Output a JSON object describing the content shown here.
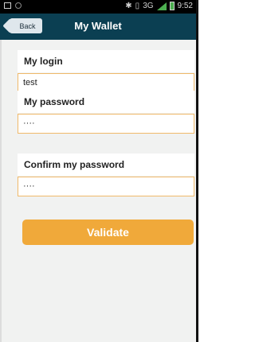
{
  "status_bar": {
    "time": "9:52"
  },
  "header": {
    "back_label": "Back",
    "title": "My Wallet"
  },
  "form": {
    "login_label": "My login",
    "login_value": "test",
    "password_label": "My password",
    "password_value": "····",
    "confirm_label": "Confirm my password",
    "confirm_value": "····"
  },
  "actions": {
    "validate_label": "Validate"
  },
  "colors": {
    "header_bg": "#0b3f52",
    "accent": "#f0a93a",
    "input_border": "#f0b96a",
    "content_bg": "#f1f2f1"
  },
  "icons": [
    "gallery-icon",
    "circle-notification-icon",
    "bluetooth-icon",
    "vibrate-icon",
    "network-3g-icon",
    "signal-icon",
    "battery-icon"
  ]
}
